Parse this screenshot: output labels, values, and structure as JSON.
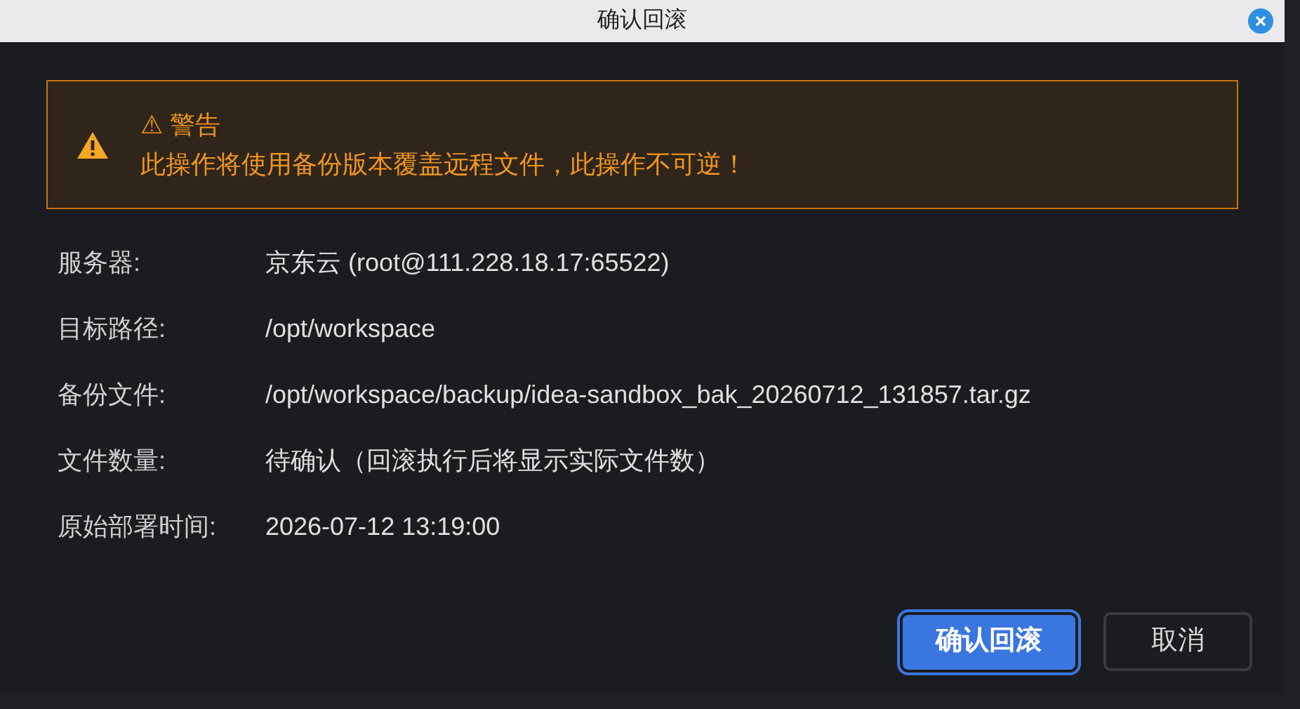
{
  "window": {
    "title": "确认回滚"
  },
  "warning": {
    "title": "⚠ 警告",
    "message": "此操作将使用备份版本覆盖远程文件，此操作不可逆！"
  },
  "details": [
    {
      "label": "服务器:",
      "value": "京东云 (root@111.228.18.17:65522)"
    },
    {
      "label": "目标路径:",
      "value": "/opt/workspace"
    },
    {
      "label": "备份文件:",
      "value": "/opt/workspace/backup/idea-sandbox_bak_20260712_131857.tar.gz"
    },
    {
      "label": "文件数量:",
      "value": "待确认（回滚执行后将显示实际文件数）"
    },
    {
      "label": "原始部署时间:",
      "value": "2026-07-12 13:19:00"
    }
  ],
  "buttons": [
    {
      "label": "确认回滚",
      "kind": "primary"
    },
    {
      "label": "取消",
      "kind": "secondary"
    }
  ]
}
